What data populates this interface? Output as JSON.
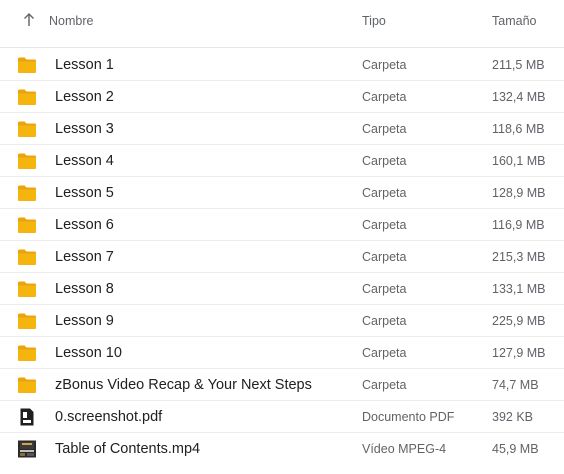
{
  "header": {
    "name": "Nombre",
    "type": "Tipo",
    "size": "Tamaño"
  },
  "colors": {
    "folder": "#f6b40e",
    "folder_tab": "#e8a40c"
  },
  "files": [
    {
      "name": "Lesson 1",
      "type": "Carpeta",
      "size": "211,5 MB",
      "icon": "folder-icon"
    },
    {
      "name": "Lesson 2",
      "type": "Carpeta",
      "size": "132,4 MB",
      "icon": "folder-icon"
    },
    {
      "name": "Lesson 3",
      "type": "Carpeta",
      "size": "118,6 MB",
      "icon": "folder-icon"
    },
    {
      "name": "Lesson 4",
      "type": "Carpeta",
      "size": "160,1 MB",
      "icon": "folder-icon"
    },
    {
      "name": "Lesson 5",
      "type": "Carpeta",
      "size": "128,9 MB",
      "icon": "folder-icon"
    },
    {
      "name": "Lesson 6",
      "type": "Carpeta",
      "size": "116,9 MB",
      "icon": "folder-icon"
    },
    {
      "name": "Lesson 7",
      "type": "Carpeta",
      "size": "215,3 MB",
      "icon": "folder-icon"
    },
    {
      "name": "Lesson 8",
      "type": "Carpeta",
      "size": "133,1 MB",
      "icon": "folder-icon"
    },
    {
      "name": "Lesson 9",
      "type": "Carpeta",
      "size": "225,9 MB",
      "icon": "folder-icon"
    },
    {
      "name": "Lesson 10",
      "type": "Carpeta",
      "size": "127,9 MB",
      "icon": "folder-icon"
    },
    {
      "name": "zBonus Video Recap & Your Next Steps",
      "type": "Carpeta",
      "size": "74,7 MB",
      "icon": "folder-icon"
    },
    {
      "name": "0.screenshot.pdf",
      "type": "Documento PDF",
      "size": "392 KB",
      "icon": "pdf-file-icon"
    },
    {
      "name": "Table of Contents.mp4",
      "type": "Vídeo MPEG-4",
      "size": "45,9 MB",
      "icon": "video-thumbnail-icon"
    }
  ]
}
